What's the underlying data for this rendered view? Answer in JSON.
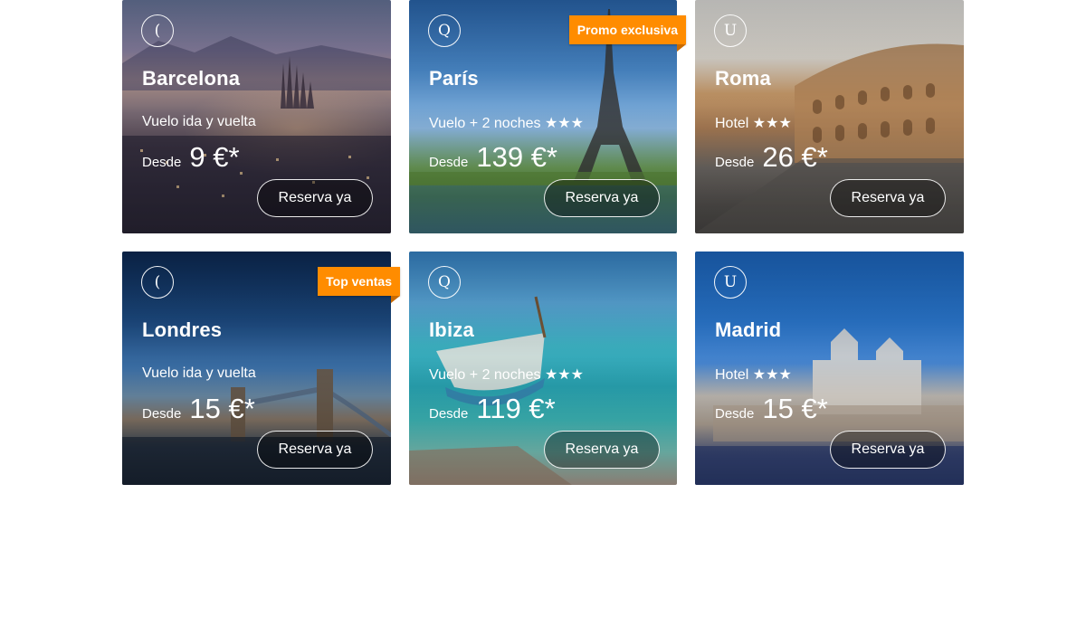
{
  "cards": [
    {
      "icon": "(",
      "icon_name": "plane-icon",
      "city": "Barcelona",
      "subtitle": "Vuelo ida y vuelta",
      "desde": "Desde",
      "price": "9 €*",
      "button": "Reserva ya",
      "ribbon": ""
    },
    {
      "icon": "Q",
      "icon_name": "plane-hotel-icon",
      "city": "París",
      "subtitle": "Vuelo + 2 noches ★★★",
      "desde": "Desde",
      "price": "139 €*",
      "button": "Reserva ya",
      "ribbon": "Promo exclusiva"
    },
    {
      "icon": "U",
      "icon_name": "hotel-icon",
      "city": "Roma",
      "subtitle": "Hotel ★★★",
      "desde": "Desde",
      "price": "26 €*",
      "button": "Reserva ya",
      "ribbon": ""
    },
    {
      "icon": "(",
      "icon_name": "plane-icon",
      "city": "Londres",
      "subtitle": "Vuelo ida y vuelta",
      "desde": "Desde",
      "price": "15 €*",
      "button": "Reserva ya",
      "ribbon": "Top ventas"
    },
    {
      "icon": "Q",
      "icon_name": "plane-hotel-icon",
      "city": "Ibiza",
      "subtitle": "Vuelo + 2 noches ★★★",
      "desde": "Desde",
      "price": "119 €*",
      "button": "Reserva ya",
      "ribbon": ""
    },
    {
      "icon": "U",
      "icon_name": "hotel-icon",
      "city": "Madrid",
      "subtitle": "Hotel ★★★",
      "desde": "Desde",
      "price": "15 €*",
      "button": "Reserva ya",
      "ribbon": ""
    }
  ],
  "colors": {
    "ribbon": "#ff8c00",
    "text": "#ffffff"
  }
}
